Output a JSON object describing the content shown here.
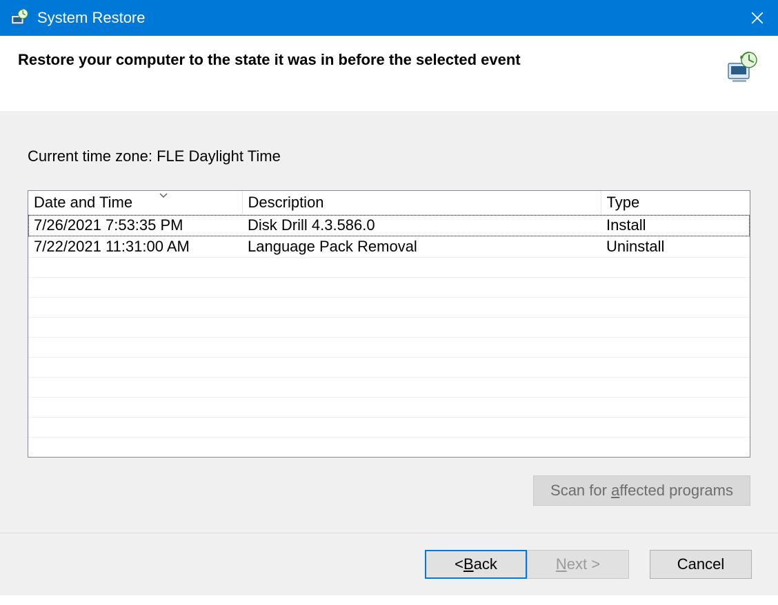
{
  "window": {
    "title": "System Restore"
  },
  "header": {
    "heading": "Restore your computer to the state it was in before the selected event"
  },
  "body": {
    "timezone_label": "Current time zone: FLE Daylight Time",
    "columns": {
      "date": "Date and Time",
      "description": "Description",
      "type": "Type"
    },
    "rows": [
      {
        "date": "7/26/2021 7:53:35 PM",
        "description": "Disk Drill 4.3.586.0",
        "type": "Install"
      },
      {
        "date": "7/22/2021 11:31:00 AM",
        "description": "Language Pack Removal",
        "type": "Uninstall"
      }
    ],
    "scan_button": {
      "pre": "Scan for ",
      "ul": "a",
      "post": "ffected programs"
    }
  },
  "footer": {
    "back": {
      "pre": "< ",
      "ul": "B",
      "post": "ack"
    },
    "next": {
      "ul": "N",
      "post": "ext >"
    },
    "cancel": "Cancel"
  }
}
